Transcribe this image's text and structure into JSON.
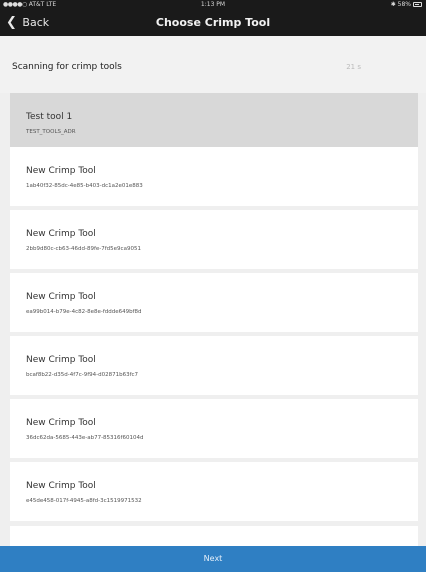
{
  "status_bar": {
    "signal": "●●●●○",
    "carrier": "AT&T  LTE",
    "time": "1:13 PM",
    "battery": "58%"
  },
  "nav": {
    "back_label": "Back",
    "title": "Choose Crimp Tool"
  },
  "scan": {
    "label": "Scanning for crimp tools",
    "timer": "21 s"
  },
  "tools": [
    {
      "name": "Test tool 1",
      "id": "TEST_TOOLS_ADR",
      "selected": true
    },
    {
      "name": "New Crimp Tool",
      "id": "1ab40f32-85dc-4e85-b403-dc1a2e01e883",
      "selected": false
    },
    {
      "name": "New Crimp Tool",
      "id": "2bb9d80c-cb63-46dd-89fe-7fd5e9ca9051",
      "selected": false
    },
    {
      "name": "New Crimp Tool",
      "id": "ea99b014-b79e-4c82-8e8e-fddde649bf8d",
      "selected": false
    },
    {
      "name": "New Crimp Tool",
      "id": "bcaf8b22-d35d-4f7c-9f94-d02871b63fc7",
      "selected": false
    },
    {
      "name": "New Crimp Tool",
      "id": "36dc62da-5685-443e-ab77-85316f60104d",
      "selected": false
    },
    {
      "name": "New Crimp Tool",
      "id": "e45de458-017f-4945-a8fd-3c1519971532",
      "selected": false
    }
  ],
  "footer": {
    "next_label": "Next"
  },
  "colors": {
    "accent": "#2f7fc3",
    "selected_row": "#d8d8d8",
    "nav_background": "#1a1a1a"
  }
}
